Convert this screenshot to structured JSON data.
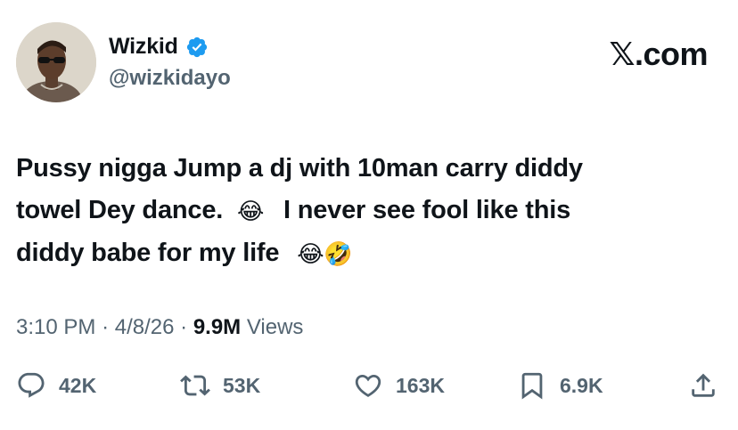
{
  "author": {
    "display_name": "Wizkid",
    "handle": "@wizkidayo",
    "verified": true
  },
  "brand": "𝕏.com",
  "tweet": {
    "lines": [
      "Pussy nigga Jump a dj with 10man carry diddy",
      "towel Dey dance.",
      "I never see fool like this",
      "diddy babe for my life"
    ],
    "emojis": {
      "after_line2": "😂",
      "after_line4_a": "😂",
      "after_line4_b": "🤣"
    }
  },
  "meta": {
    "time": "3:10 PM",
    "date": "4/8/26",
    "views_count": "9.9M",
    "views_label": "Views",
    "separator": "·"
  },
  "actions": {
    "replies": "42K",
    "reposts": "53K",
    "likes": "163K",
    "bookmarks": "6.9K"
  },
  "colors": {
    "text": "#0f1419",
    "muted": "#536471",
    "verified": "#1d9bf0"
  },
  "icons": [
    "verified-icon",
    "reply-icon",
    "repost-icon",
    "like-icon",
    "bookmark-icon",
    "share-icon"
  ]
}
